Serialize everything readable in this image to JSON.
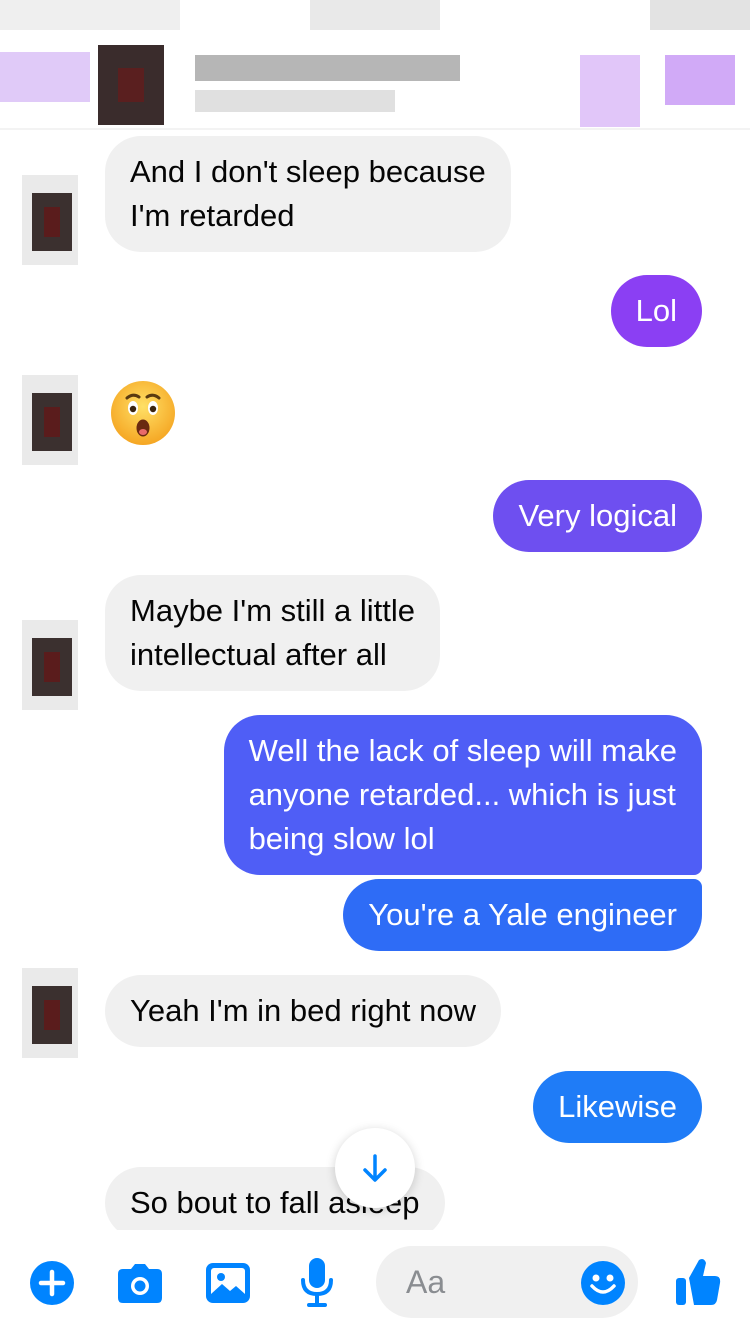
{
  "colors": {
    "accent": "#0084ff",
    "incoming_bg": "#f0f0f0",
    "outgoing_purple": "#8b3ff3",
    "outgoing_violet": "#6e4ff0",
    "outgoing_indigo": "#4f5ef6",
    "outgoing_blue": "#2e6cf6",
    "outgoing_bright_blue": "#1f7cf7"
  },
  "messages": [
    {
      "id": "m1",
      "side": "in",
      "lines": [
        "And I don't sleep because",
        "I'm retarded"
      ]
    },
    {
      "id": "m2",
      "side": "out",
      "text": "Lol"
    },
    {
      "id": "m3",
      "side": "in",
      "emoji": "astonished-face"
    },
    {
      "id": "m4",
      "side": "out",
      "text": "Very logical"
    },
    {
      "id": "m5",
      "side": "in",
      "lines": [
        "Maybe I'm still a little",
        "intellectual after all"
      ]
    },
    {
      "id": "m6",
      "side": "out",
      "lines": [
        "Well the lack of sleep will make",
        "anyone retarded... which is just",
        "being slow lol"
      ]
    },
    {
      "id": "m7",
      "side": "out",
      "text": "You're a Yale engineer"
    },
    {
      "id": "m8",
      "side": "in",
      "text": "Yeah I'm in bed right now"
    },
    {
      "id": "m9",
      "side": "out",
      "text": "Likewise"
    },
    {
      "id": "m10",
      "side": "in",
      "text": "So bout to fall asleep"
    }
  ],
  "composer": {
    "placeholder": "Aa",
    "icons": [
      "plus-icon",
      "camera-icon",
      "photo-icon",
      "microphone-icon",
      "emoji-icon",
      "thumbs-up-icon"
    ]
  },
  "scroll_button_icon": "arrow-down-icon"
}
